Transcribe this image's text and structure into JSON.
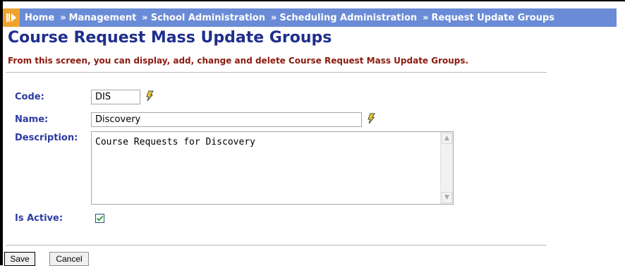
{
  "breadcrumb": {
    "items": [
      "Home",
      "Management",
      "School Administration",
      "Scheduling Administration",
      "Request Update Groups"
    ],
    "separator": "»"
  },
  "page": {
    "title": "Course Request Mass Update Groups",
    "subtitle": "From this screen, you can display, add, change and delete Course Request Mass Update Groups."
  },
  "form": {
    "code_label": "Code:",
    "code_value": "DIS",
    "name_label": "Name:",
    "name_value": "Discovery",
    "description_label": "Description:",
    "description_value": "Course Requests for Discovery",
    "is_active_label": "Is Active:",
    "is_active_checked": true
  },
  "buttons": {
    "save": "Save",
    "cancel": "Cancel"
  },
  "colors": {
    "breadcrumb_bg": "#6a8bd6",
    "logo_bg": "#f0a22d",
    "title": "#1f2f8d",
    "subtitle": "#8b1a0e",
    "label": "#2d3ba0",
    "lightning": "#f5d01e"
  },
  "icons": {
    "logo": "play-forward-icon",
    "quick_lookup": "lightning-icon"
  }
}
